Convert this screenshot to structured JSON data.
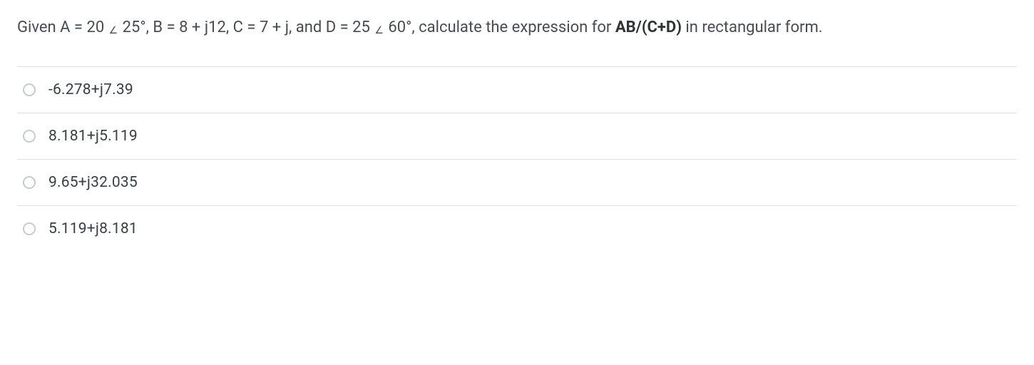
{
  "question": {
    "prefix": "Given A = 20 ",
    "angle1": "∠",
    "a_deg": " 25°, B = 8 + j12, C = 7 + j, and D = 25 ",
    "angle2": "∠",
    "d_deg": " 60°, calculate the expression for ",
    "bold_expr": "AB/(C+D)",
    "suffix": " in rectangular form."
  },
  "options": [
    {
      "label": "-6.278+j7.39"
    },
    {
      "label": "8.181+j5.119"
    },
    {
      "label": "9.65+j32.035"
    },
    {
      "label": "5.119+j8.181"
    }
  ]
}
